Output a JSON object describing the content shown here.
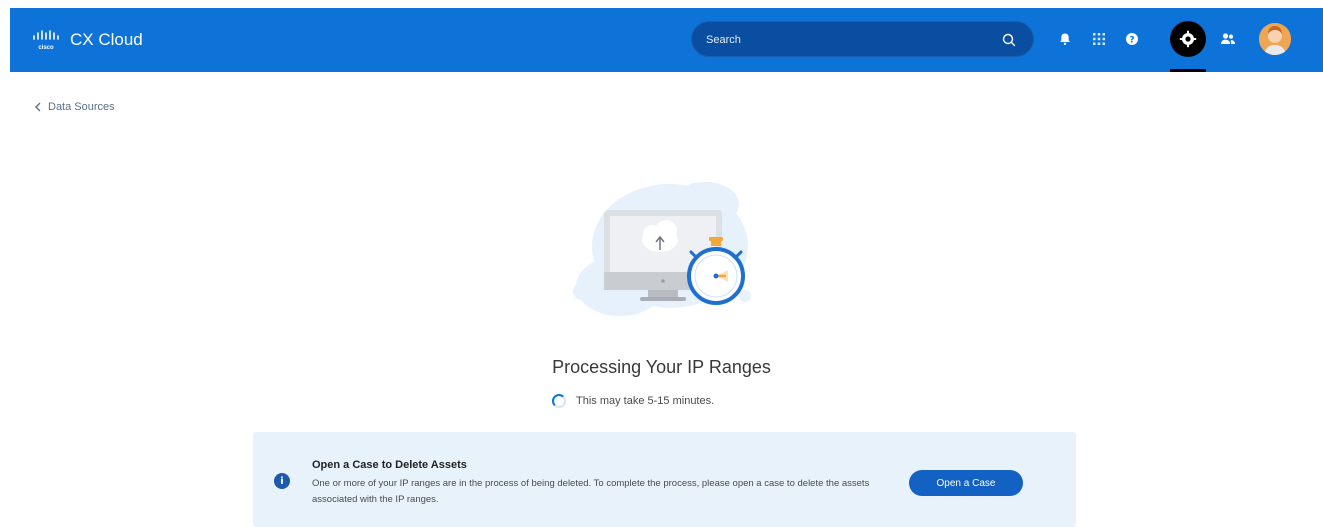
{
  "header": {
    "brand_logo_text": "cisco",
    "app_title": "CX Cloud",
    "search_placeholder": "Search",
    "icons": [
      "search-icon",
      "bell-icon",
      "apps-grid-icon",
      "help-icon",
      "settings-icon",
      "team-icon",
      "avatar"
    ]
  },
  "nav": {
    "back_label": "Data Sources"
  },
  "main": {
    "title": "Processing Your IP Ranges",
    "status": "This may take 5-15 minutes."
  },
  "alert": {
    "title": "Open a Case to Delete Assets",
    "body": "One or more of your IP ranges are in the process of being deleted. To complete the process, please open a case to delete the assets associated with the IP ranges.",
    "button_label": "Open a Case"
  },
  "colors": {
    "header_bg": "#0d73d9",
    "accent": "#1461c4",
    "alert_bg": "#e8f2fb"
  }
}
